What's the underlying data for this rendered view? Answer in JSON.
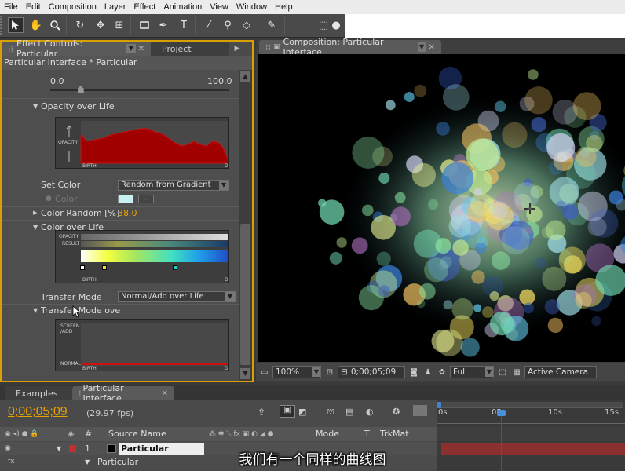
{
  "menubar": {
    "items": [
      "File",
      "Edit",
      "Composition",
      "Layer",
      "Effect",
      "Animation",
      "View",
      "Window",
      "Help"
    ]
  },
  "toolbar": {
    "tools": [
      "selection-tool",
      "hand-tool",
      "zoom-tool",
      "rotation-tool",
      "orbit-camera-tool",
      "pan-behind-tool",
      "rectangle-mask-tool",
      "pen-tool",
      "text-tool",
      "brush-tool",
      "clone-stamp-tool",
      "eraser-tool",
      "puppet-pin-tool"
    ]
  },
  "effect_panel": {
    "tabs": [
      "Effect Controls: Particular",
      "Project"
    ],
    "title": "Particular Interface * Particular",
    "slider_min": "0.0",
    "slider_max": "100.0",
    "slider_value_pct": 17,
    "opacity_over_life": "Opacity over Life",
    "opacity_graph": {
      "ylabel": "OPACITY",
      "xstart": "BIRTH",
      "xend": "D"
    },
    "set_color_label": "Set Color",
    "set_color_value": "Random from Gradient",
    "color_label": "Color",
    "color_swatch": "#c8f0f0",
    "color_random_label": "Color Random [%]",
    "color_random_value": "38.0",
    "color_over_life": "Color over Life",
    "color_graph": {
      "row1": "OPACITY",
      "row2": "RESULT",
      "xstart": "BIRTH",
      "xend": "D"
    },
    "transfer_mode_label": "Transfer Mode",
    "transfer_mode_value": "Normal/Add over Life",
    "transfer_mode_ove": "Transfer Mode ove",
    "transfer_graph": {
      "top": "SCREEN\n/ADD",
      "bottom": "NORMAL",
      "xstart": "BIRTH",
      "xend": "D"
    }
  },
  "comp_panel": {
    "tab": "Composition: Particular Interface",
    "zoom": "100%",
    "timecode": "0;00;05;09",
    "resolution": "Full",
    "camera": "Active Camera"
  },
  "timeline": {
    "tabs": [
      "Examples",
      "Particular Interface"
    ],
    "timecode": "0;00;05;09",
    "fps": "(29.97 fps)",
    "col_source": "Source Name",
    "col_mode": "Mode",
    "col_t": "T",
    "col_trkmat": "TrkMat",
    "layer_num": "1",
    "layer_name": "Particular",
    "sub_name": "Particular",
    "ruler": [
      "0s",
      "05s",
      "10s",
      "15s"
    ]
  },
  "subtitle": "我们有一个同样的曲线图",
  "colors": {
    "accent": "#e8a200",
    "panel_border": "#d8a000",
    "curve_fill": "#a00000",
    "playhead": "#d02020"
  }
}
